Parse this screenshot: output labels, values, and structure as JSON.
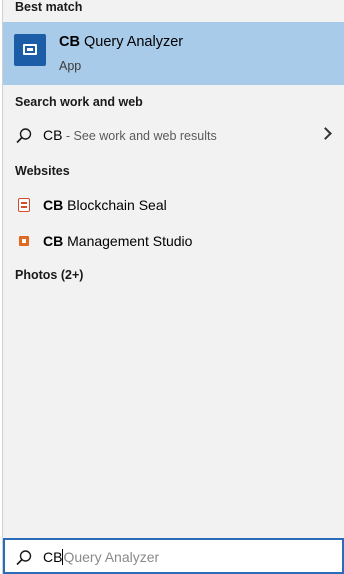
{
  "best_match": {
    "section_label": "Best match",
    "app_prefix": "CB",
    "app_rest": "Query Analyzer",
    "app_type": "App"
  },
  "search_web": {
    "section_label": "Search work and web",
    "query": "CB",
    "suffix": " - See work and web results"
  },
  "websites": {
    "section_label": "Websites",
    "items": [
      {
        "prefix": "CB",
        "rest": "Blockchain Seal"
      },
      {
        "prefix": "CB",
        "rest": "Management Studio"
      }
    ]
  },
  "photos": {
    "section_label": "Photos (2+)"
  },
  "searchbar": {
    "typed": "CB",
    "completion": "Query Analyzer"
  },
  "colors": {
    "highlight": "#a9cbea",
    "app_icon": "#1b5da6",
    "searchbar_border": "#2b6cb8"
  }
}
